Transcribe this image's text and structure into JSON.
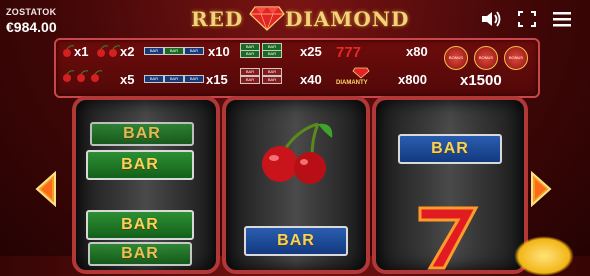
{
  "balance": {
    "label": "ZOSTATOK",
    "value": "€984.00"
  },
  "logo": {
    "word1": "RED",
    "word2": "DIAMOND"
  },
  "header_icons": [
    "speaker-icon",
    "fullscreen-icon",
    "menu-icon"
  ],
  "paytable": {
    "row1": [
      {
        "symbols": "cherry x1",
        "mult": "x1"
      },
      {
        "symbols": "cherry x2",
        "mult": "x2"
      },
      {
        "symbols": "mixed bars",
        "mult": "x10"
      },
      {
        "symbols": "green bars",
        "mult": "x25"
      },
      {
        "symbols": "sevens",
        "mult": "x80"
      }
    ],
    "row2": [
      {
        "symbols": "cherries",
        "mult": "x5"
      },
      {
        "symbols": "blue bars",
        "mult": "x15"
      },
      {
        "symbols": "red bars",
        "mult": "x40"
      },
      {
        "symbols": "diamonds",
        "mult": "x800"
      },
      {
        "symbols": "bonus",
        "mult": "x1500"
      }
    ],
    "bonus_text": "BONUS",
    "diamond_text": "DIAMANTY"
  },
  "reels": {
    "reel1": [
      "BAR",
      "BAR",
      "BAR",
      "BAR"
    ],
    "reel2": [
      "cherries",
      "BAR"
    ],
    "reel3": [
      "BAR",
      "seven"
    ]
  },
  "colors": {
    "frame": "#b23838",
    "gold": "#f5d35a",
    "bar_green": "#1b6a22",
    "bar_blue": "#123a80"
  }
}
